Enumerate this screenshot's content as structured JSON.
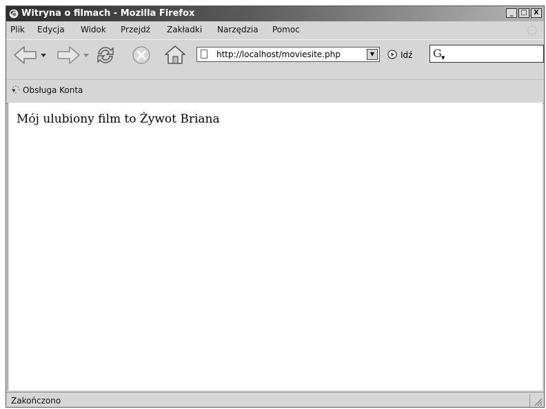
{
  "window": {
    "title": "Witryna o filmach - Mozilla Firefox",
    "controls": {
      "minimize": "_",
      "maximize": "□",
      "close": "X"
    }
  },
  "menu": {
    "items": [
      {
        "label": "Plik"
      },
      {
        "label": "Edycja"
      },
      {
        "label": "Widok"
      },
      {
        "label": "Przejdź"
      },
      {
        "label": "Zakładki"
      },
      {
        "label": "Narzędzia"
      },
      {
        "label": "Pomoc"
      }
    ]
  },
  "navigation": {
    "icons": [
      "back-arrow-icon",
      "forward-arrow-icon",
      "reload-icon",
      "stop-icon",
      "home-icon"
    ],
    "url": "http://localhost/moviesite.php",
    "go_label": "Idź",
    "search_engine_glyph": "G"
  },
  "bookmarks": {
    "items": [
      {
        "label": "Obsługa Konta"
      }
    ]
  },
  "page": {
    "text": "Mój ulubiony film to Żywot Briana"
  },
  "status": {
    "text": "Zakończono"
  }
}
